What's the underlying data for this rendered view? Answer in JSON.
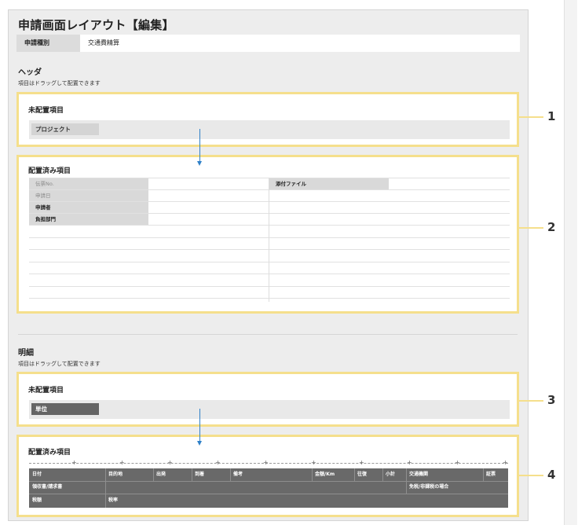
{
  "page": {
    "title": "申請画面レイアウト【編集】",
    "type_label": "申請種別",
    "type_value": "交通費精算"
  },
  "header_section": {
    "title": "ヘッダ",
    "description": "項目はドラッグして配置できます",
    "unplaced": {
      "title": "未配置項目",
      "items": [
        "プロジェクト"
      ]
    },
    "placed": {
      "title": "配置済み項目",
      "left_items": [
        "伝票No.",
        "申請日",
        "申請者",
        "負担部門"
      ],
      "right_items": [
        "添付ファイル"
      ]
    }
  },
  "detail_section": {
    "title": "明細",
    "description": "項目はドラッグして配置できます",
    "unplaced": {
      "title": "未配置項目",
      "items": [
        "単位"
      ]
    },
    "placed": {
      "title": "配置済み項目",
      "row1": [
        "日付",
        "目的地",
        "出発",
        "到着",
        "備考",
        "金額/Km",
        "往復",
        "小計",
        "交通機関",
        "証票"
      ],
      "row2": [
        "領収書/請求書",
        "免税/非課税の場合"
      ],
      "row3": [
        "税額",
        "税率"
      ]
    }
  },
  "markers": [
    "1",
    "2",
    "3",
    "4"
  ],
  "colors": {
    "highlight_border": "#f5df8c",
    "arrow": "#2f80c8",
    "dark_chip": "#656565"
  }
}
